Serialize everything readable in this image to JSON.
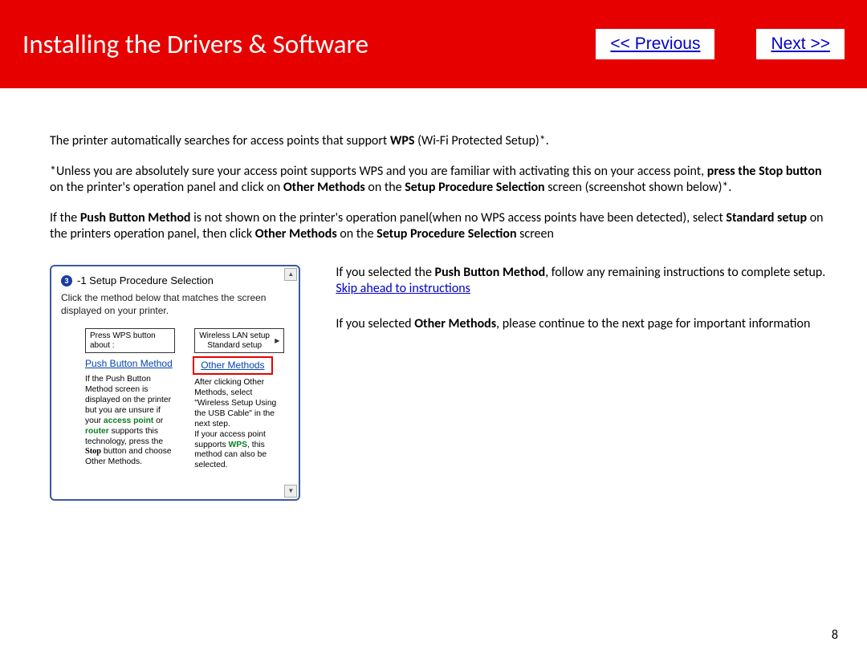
{
  "header": {
    "title": "Installing  the Drivers & Software",
    "prev_label": "<< Previous",
    "next_label": "Next >>"
  },
  "body": {
    "p1_pre": "The printer automatically searches for access points that support ",
    "p1_bold": "WPS",
    "p1_post": " (Wi-Fi Protected Setup)*.",
    "p2_a": "*Unless you are absolutely sure your access point supports WPS and you are familiar with activating  this on your access point, ",
    "p2_b": "press the Stop button",
    "p2_c": " on the printer's operation panel and click on  ",
    "p2_d": "Other Methods",
    "p2_e": " on the ",
    "p2_f": "Setup Procedure Selection",
    "p2_g": " screen (screenshot shown below)*.",
    "p3_a": "If the ",
    "p3_b": "Push Button Method",
    "p3_c": " is not shown  on the printer's operation panel(when no WPS access points have been detected), select ",
    "p3_d": "Standard setup",
    "p3_e": " on the printers operation panel, then click ",
    "p3_f": "Other Methods",
    "p3_g": " on the ",
    "p3_h": "Setup Procedure Selection",
    "p3_i": " screen"
  },
  "dialog": {
    "step_num": "3",
    "step_suffix": "-1 Setup Procedure Selection",
    "prompt": "Click the method below that matches the screen displayed on your printer.",
    "left": {
      "box": "Press WPS button about :",
      "link": "Push Button Method",
      "desc_pre": "If the Push Button Method screen is displayed on the printer but you are unsure if your ",
      "desc_green1": "access point",
      "desc_mid1": " or ",
      "desc_green2": "router",
      "desc_mid2": " supports this technology, press the ",
      "desc_stop": "Stop",
      "desc_post": " button and choose Other Methods."
    },
    "right": {
      "box_l1": "Wireless LAN setup",
      "box_l2": "Standard setup",
      "link": "Other Methods",
      "desc_a": "After clicking Other Methods, select \"Wireless Setup Using the USB Cable\" in the next step.",
      "desc_b_pre": "If your access point supports ",
      "desc_b_green": "WPS",
      "desc_b_post": ", this method can also be selected."
    }
  },
  "rightcol": {
    "r1_a": "If you selected the ",
    "r1_b": "Push Button Method",
    "r1_c": ", follow any remaining instructions to complete setup. ",
    "r1_link": "Skip ahead to instructions",
    "r2_a": "If you selected ",
    "r2_b": "Other Methods",
    "r2_c": ", please continue to the next page  for important information"
  },
  "page_number": "8"
}
